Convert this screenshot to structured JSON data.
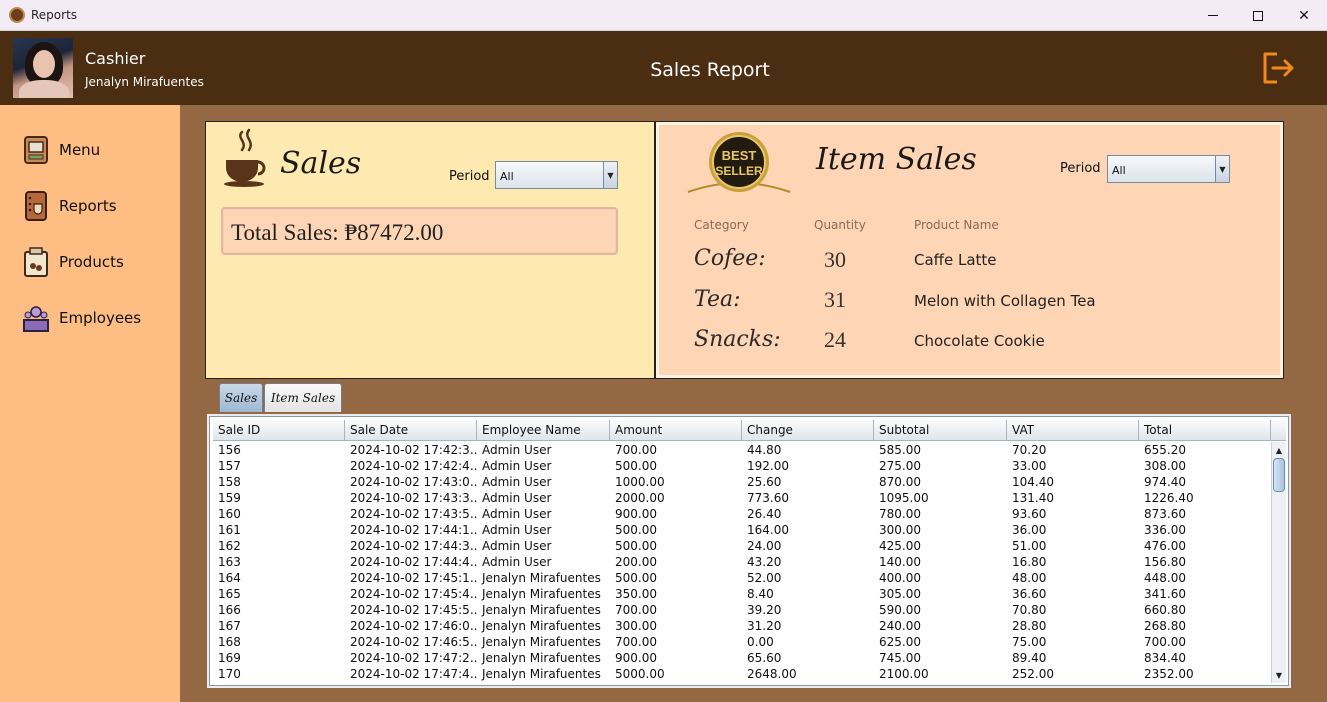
{
  "window": {
    "title": "Reports"
  },
  "header": {
    "role": "Cashier",
    "user_name": "Jenalyn Mirafuentes",
    "page_title": "Sales Report"
  },
  "sidebar": {
    "items": [
      {
        "label": "Menu",
        "icon": "menu-icon"
      },
      {
        "label": "Reports",
        "icon": "reports-icon"
      },
      {
        "label": "Products",
        "icon": "products-icon"
      },
      {
        "label": "Employees",
        "icon": "employees-icon"
      }
    ]
  },
  "sales_panel": {
    "title": "Sales",
    "period_label": "Period",
    "period_value": "All",
    "total_sales": "Total Sales: ₱87472.00"
  },
  "item_sales_panel": {
    "title": "Item Sales",
    "badge_text_1": "BEST",
    "badge_text_2": "SELLER",
    "period_label": "Period",
    "period_value": "All",
    "columns": [
      "Category",
      "Quantity",
      "Product Name"
    ],
    "rows": [
      {
        "category": "Cofee:",
        "quantity": "30",
        "product": "Caffe Latte"
      },
      {
        "category": "Tea:",
        "quantity": "31",
        "product": "Melon with Collagen Tea"
      },
      {
        "category": "Snacks:",
        "quantity": "24",
        "product": "Chocolate Cookie"
      }
    ]
  },
  "tabs": [
    {
      "label": "Sales",
      "active": true
    },
    {
      "label": "Item Sales",
      "active": false
    }
  ],
  "table": {
    "columns": [
      "Sale ID",
      "Sale Date",
      "Employee Name",
      "Amount",
      "Change",
      "Subtotal",
      "VAT",
      "Total"
    ],
    "rows": [
      [
        "156",
        "2024-10-02 17:42:3...",
        "Admin User",
        "700.00",
        "44.80",
        "585.00",
        "70.20",
        "655.20"
      ],
      [
        "157",
        "2024-10-02 17:42:4...",
        "Admin User",
        "500.00",
        "192.00",
        "275.00",
        "33.00",
        "308.00"
      ],
      [
        "158",
        "2024-10-02 17:43:0...",
        "Admin User",
        "1000.00",
        "25.60",
        "870.00",
        "104.40",
        "974.40"
      ],
      [
        "159",
        "2024-10-02 17:43:3...",
        "Admin User",
        "2000.00",
        "773.60",
        "1095.00",
        "131.40",
        "1226.40"
      ],
      [
        "160",
        "2024-10-02 17:43:5...",
        "Admin User",
        "900.00",
        "26.40",
        "780.00",
        "93.60",
        "873.60"
      ],
      [
        "161",
        "2024-10-02 17:44:1...",
        "Admin User",
        "500.00",
        "164.00",
        "300.00",
        "36.00",
        "336.00"
      ],
      [
        "162",
        "2024-10-02 17:44:3...",
        "Admin User",
        "500.00",
        "24.00",
        "425.00",
        "51.00",
        "476.00"
      ],
      [
        "163",
        "2024-10-02 17:44:4...",
        "Admin User",
        "200.00",
        "43.20",
        "140.00",
        "16.80",
        "156.80"
      ],
      [
        "164",
        "2024-10-02 17:45:1...",
        "Jenalyn Mirafuentes",
        "500.00",
        "52.00",
        "400.00",
        "48.00",
        "448.00"
      ],
      [
        "165",
        "2024-10-02 17:45:4...",
        "Jenalyn Mirafuentes",
        "350.00",
        "8.40",
        "305.00",
        "36.60",
        "341.60"
      ],
      [
        "166",
        "2024-10-02 17:45:5...",
        "Jenalyn Mirafuentes",
        "700.00",
        "39.20",
        "590.00",
        "70.80",
        "660.80"
      ],
      [
        "167",
        "2024-10-02 17:46:0...",
        "Jenalyn Mirafuentes",
        "300.00",
        "31.20",
        "240.00",
        "28.80",
        "268.80"
      ],
      [
        "168",
        "2024-10-02 17:46:5...",
        "Jenalyn Mirafuentes",
        "700.00",
        "0.00",
        "625.00",
        "75.00",
        "700.00"
      ],
      [
        "169",
        "2024-10-02 17:47:2...",
        "Jenalyn Mirafuentes",
        "900.00",
        "65.60",
        "745.00",
        "89.40",
        "834.40"
      ],
      [
        "170",
        "2024-10-02 17:47:4...",
        "Jenalyn Mirafuentes",
        "5000.00",
        "2648.00",
        "2100.00",
        "252.00",
        "2352.00"
      ]
    ]
  },
  "colors": {
    "header_bg": "#4b2d12",
    "sidebar_bg": "#febd82",
    "content_bg": "#936842",
    "sales_panel_bg": "#fee9b0",
    "item_panel_bg": "#fed6b6",
    "logout_accent": "#f08a1c"
  }
}
